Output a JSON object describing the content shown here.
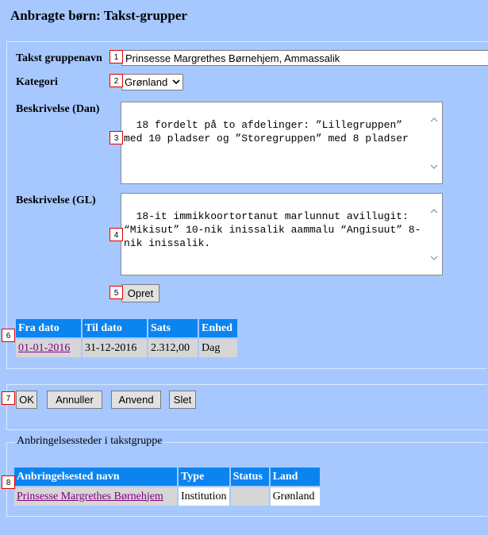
{
  "page": {
    "title": "Anbragte børn: Takst-grupper"
  },
  "form": {
    "name_label": "Takst gruppenavn",
    "name_value": "Prinsesse Margrethes Børnehjem, Ammassalik",
    "category_label": "Kategori",
    "category_value": "Grønland",
    "desc_dan_label": "Beskrivelse (Dan)",
    "desc_dan_value": "18 fordelt på to afdelinger: ”Lillegruppen” med 10 pladser og ”Storegruppen” med 8 pladser",
    "desc_gl_label": "Beskrivelse (GL)",
    "desc_gl_value": "18-it immikkoortortanut marlunnut avillugit: “Mikisut” 10-nik inissalik aammalu “Angisuut” 8-nik inissalik.",
    "create_label": "Opret"
  },
  "rates_table": {
    "headers": [
      "Fra dato",
      "Til dato",
      "Sats",
      "Enhed"
    ],
    "rows": [
      [
        "01-01-2016",
        "31-12-2016",
        "2.312,00",
        "Dag"
      ]
    ]
  },
  "actions": {
    "ok": "OK",
    "cancel": "Annuller",
    "apply": "Anvend",
    "delete": "Slet"
  },
  "placements": {
    "legend": "Anbringelsessteder i takstgruppe",
    "headers": [
      "Anbringelsested navn",
      "Type",
      "Status",
      "Land"
    ],
    "rows": [
      [
        "Prinsesse Margrethes Børnehjem",
        "Institution",
        "",
        "Grønland"
      ]
    ]
  },
  "markers": [
    "1",
    "2",
    "3",
    "4",
    "5",
    "6",
    "7",
    "8"
  ]
}
